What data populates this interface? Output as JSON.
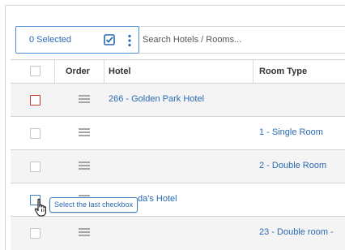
{
  "toolbar": {
    "selected_label": "0 Selected",
    "select_all_icon": "checkbox-checked-icon",
    "more_icon": "vertical-ellipsis-icon",
    "search_placeholder": "Search Hotels / Rooms..."
  },
  "table": {
    "columns": [
      "",
      "Order",
      "Hotel",
      "Room Type"
    ],
    "rows": [
      {
        "checkbox_state": "highlighted-red",
        "drag_icon": "drag-handle-icon",
        "hotel": "266 - Golden Park Hotel",
        "room_type": ""
      },
      {
        "checkbox_state": "unchecked",
        "drag_icon": "drag-handle-icon",
        "hotel": "",
        "room_type": "1 - Single Room"
      },
      {
        "checkbox_state": "unchecked",
        "drag_icon": "drag-handle-icon",
        "hotel": "",
        "room_type": "2 - Double Room"
      },
      {
        "checkbox_state": "hover",
        "drag_icon": "drag-handle-icon",
        "hotel": "da's Hotel",
        "room_type": ""
      },
      {
        "checkbox_state": "unchecked",
        "drag_icon": "drag-handle-icon",
        "hotel": "",
        "room_type": "23 - Double room -"
      }
    ]
  },
  "tooltip": {
    "text": "Select the last checkbox"
  },
  "cursor": {
    "icon": "hand-pointer-icon"
  },
  "colors": {
    "link": "#2a6ab4",
    "accent_border": "#4d8fd6",
    "error_border": "#c0392b",
    "row_alt": "#f4f4f4"
  }
}
